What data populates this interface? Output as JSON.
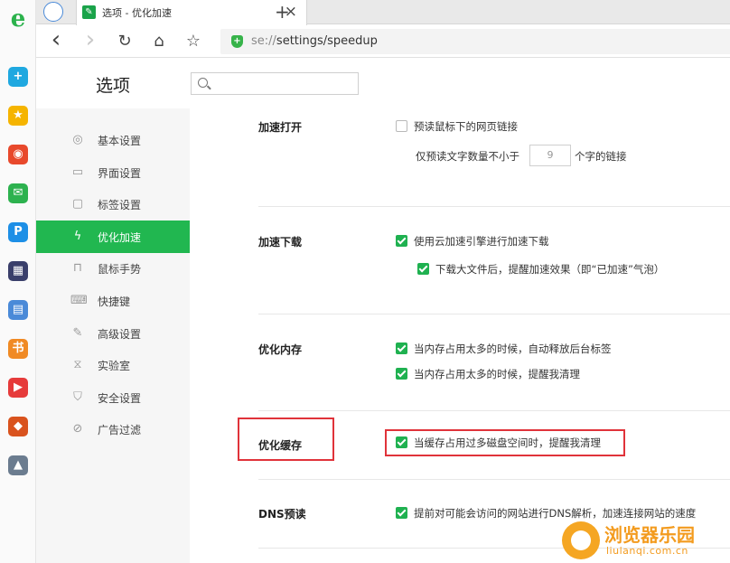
{
  "colors": {
    "accent": "#21b750",
    "highlight": "#e0333a",
    "watermark": "#f39b1e"
  },
  "rail": {
    "logo": "e",
    "apps": [
      {
        "icon": "medical-cross-icon",
        "glyph": "+",
        "color": "#1fa8e0"
      },
      {
        "icon": "star-icon",
        "glyph": "★",
        "color": "#f5b400"
      },
      {
        "icon": "weibo-icon",
        "glyph": "◉",
        "color": "#e8492c"
      },
      {
        "icon": "mail-icon",
        "glyph": "✉",
        "color": "#2db24f"
      },
      {
        "icon": "p-app-icon",
        "glyph": "P",
        "color": "#1d8fe6"
      },
      {
        "icon": "game-app-icon",
        "glyph": "▦",
        "color": "#3a3f6b"
      },
      {
        "icon": "document-app-icon",
        "glyph": "▤",
        "color": "#4a8ad8"
      },
      {
        "icon": "novel-app-icon",
        "glyph": "书",
        "color": "#f08a24"
      },
      {
        "icon": "mini-game-icon",
        "glyph": "▶",
        "color": "#e63b3b"
      },
      {
        "icon": "hero-game-icon",
        "glyph": "◆",
        "color": "#d9531e"
      },
      {
        "icon": "battle-game-icon",
        "glyph": "▲",
        "color": "#6b7c8f"
      }
    ]
  },
  "tab": {
    "title": "选项 - 优化加速",
    "close": "×",
    "new_tab": "+"
  },
  "nav": {
    "back": "‹",
    "forward": "›",
    "reload": "↻",
    "home": "⌂",
    "bookmark": "☆"
  },
  "address": {
    "scheme": "se://",
    "path": "settings/speedup"
  },
  "sidebar": {
    "title": "选项",
    "items": [
      {
        "label": "基本设置",
        "icon": "circle-settings-icon",
        "glyph": "◎"
      },
      {
        "label": "界面设置",
        "icon": "window-icon",
        "glyph": "▭"
      },
      {
        "label": "标签设置",
        "icon": "tab-icon",
        "glyph": "▢"
      },
      {
        "label": "优化加速",
        "icon": "lightning-icon",
        "glyph": "ϟ"
      },
      {
        "label": "鼠标手势",
        "icon": "mouse-icon",
        "glyph": "⊓"
      },
      {
        "label": "快捷键",
        "icon": "keyboard-icon",
        "glyph": "⌨"
      },
      {
        "label": "高级设置",
        "icon": "wrench-icon",
        "glyph": "✎"
      },
      {
        "label": "实验室",
        "icon": "flask-icon",
        "glyph": "⧖"
      },
      {
        "label": "安全设置",
        "icon": "shield-icon",
        "glyph": "⛉"
      },
      {
        "label": "广告过滤",
        "icon": "block-icon",
        "glyph": "⊘"
      }
    ]
  },
  "sections": {
    "open": {
      "label": "加速打开",
      "prefetch": "预读鼠标下的网页链接",
      "min_prefix": "仅预读文字数量不小于",
      "min_value": "9",
      "min_suffix": "个字的链接"
    },
    "download": {
      "label": "加速下载",
      "cloud": "使用云加速引擎进行加速下载",
      "notify": "下载大文件后，提醒加速效果（即“已加速”气泡）"
    },
    "memory": {
      "label": "优化内存",
      "auto_release": "当内存占用太多的时候，自动释放后台标签",
      "remind": "当内存占用太多的时候，提醒我清理"
    },
    "cache": {
      "label": "优化缓存",
      "remind": "当缓存占用过多磁盘空间时，提醒我清理"
    },
    "dns": {
      "label": "DNS预读",
      "prefetch": "提前对可能会访问的网站进行DNS解析，加速连接网站的速度"
    }
  },
  "watermark": {
    "title": "浏览器乐园",
    "url": "liulanqi.com.cn"
  }
}
